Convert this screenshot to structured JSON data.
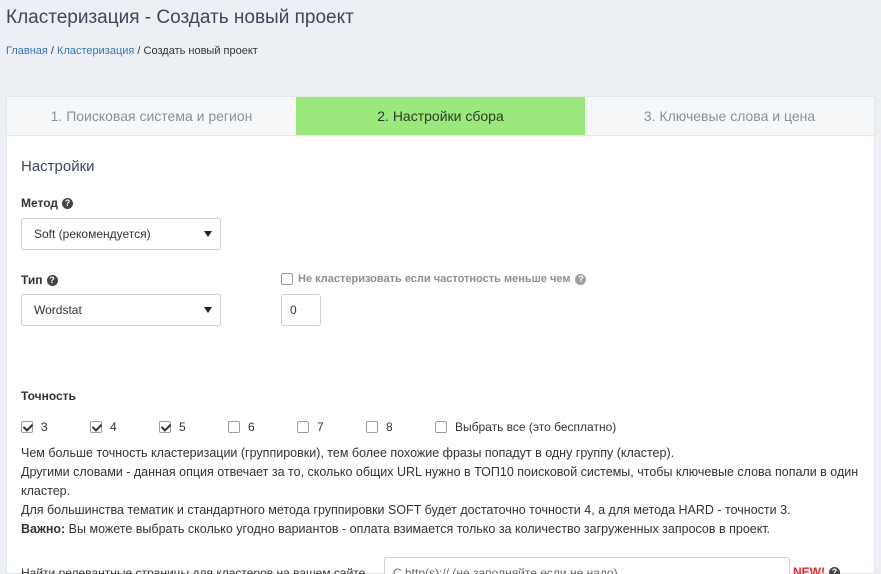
{
  "page": {
    "title": "Кластеризация - Создать новый проект"
  },
  "breadcrumb": {
    "home": "Главная",
    "sep1": " / ",
    "section": "Кластеризация",
    "sep2": " / ",
    "current": "Создать новый проект"
  },
  "tabs": [
    {
      "label": "1. Поисковая система и регион",
      "active": false
    },
    {
      "label": "2. Настройки сбора",
      "active": true
    },
    {
      "label": "3. Ключевые слова и цена",
      "active": false
    }
  ],
  "settings": {
    "title": "Настройки",
    "method": {
      "label": "Метод",
      "value": "Soft (рекомендуется)"
    },
    "type": {
      "label": "Тип",
      "value": "Wordstat"
    },
    "no_cluster": {
      "label": "Не кластеризовать если частотность меньше чем",
      "checked": false,
      "value": "0"
    },
    "precision": {
      "label": "Точность",
      "options": [
        {
          "label": "3",
          "checked": true
        },
        {
          "label": "4",
          "checked": true
        },
        {
          "label": "5",
          "checked": true
        },
        {
          "label": "6",
          "checked": false
        },
        {
          "label": "7",
          "checked": false
        },
        {
          "label": "8",
          "checked": false
        },
        {
          "label": "Выбрать все (это бесплатно)",
          "checked": false
        }
      ]
    },
    "description": {
      "line1": "Чем больше точность кластеризации (группировки), тем более похожие фразы попадут в одну группу (кластер).",
      "line2": "Другими словами - данная опция отвечает за то, сколько общих URL нужно в ТОП10 поисковой системы, чтобы ключевые слова попали в один кластер.",
      "line3": "Для большинства тематик и стандартного метода группировки SOFT будет достаточно точности 4, а для метода HARD - точности 3.",
      "important_label": "Важно:",
      "important_text": " Вы можете выбрать сколько угодно вариантов - оплата взимается только за количество загруженных запросов в проект."
    },
    "relevant": {
      "label": "Найти релевантные страницы для кластеров на вашем сайте",
      "placeholder": "С http(s):// (не заполняйте если не надо)",
      "badge": "NEW!"
    }
  },
  "icons": {
    "help": "question-circle-icon",
    "caret": "caret-down-icon",
    "check": "checkmark-icon"
  },
  "colors": {
    "active_tab": "#9be97c",
    "link": "#337ab7",
    "new_badge": "#e8262a"
  }
}
